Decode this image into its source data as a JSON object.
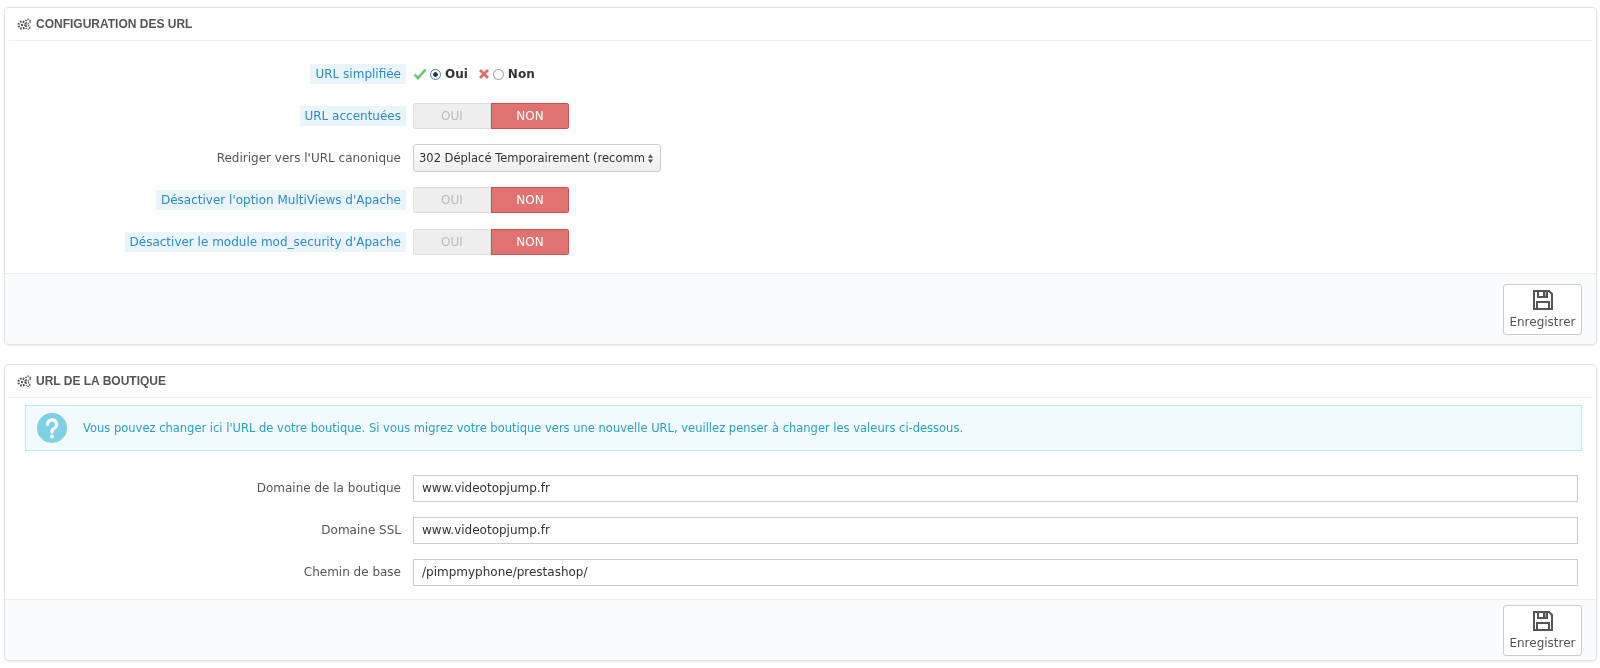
{
  "panels": [
    {
      "title": "CONFIGURATION DES URL",
      "fields": [
        {
          "kind": "radio",
          "label": "URL simplifiée",
          "hint": true,
          "options": [
            {
              "label": "Oui",
              "selected": true
            },
            {
              "label": "Non",
              "selected": false
            }
          ]
        },
        {
          "kind": "switch",
          "label": "URL accentuées",
          "hint": true,
          "options": [
            {
              "label": "OUI",
              "selected": false
            },
            {
              "label": "NON",
              "selected": true
            }
          ]
        },
        {
          "kind": "select",
          "label": "Rediriger vers l'URL canonique",
          "hint": false,
          "value": "302 Déplacé Temporairement (recomm"
        },
        {
          "kind": "switch",
          "label": "Désactiver l'option MultiViews d'Apache",
          "hint": true,
          "options": [
            {
              "label": "OUI",
              "selected": false
            },
            {
              "label": "NON",
              "selected": true
            }
          ]
        },
        {
          "kind": "switch",
          "label": "Désactiver le module mod_security d'Apache",
          "hint": true,
          "options": [
            {
              "label": "OUI",
              "selected": false
            },
            {
              "label": "NON",
              "selected": true
            }
          ]
        }
      ],
      "save_button": "Enregistrer"
    },
    {
      "title": "URL DE LA BOUTIQUE",
      "alert": "Vous pouvez changer ici l'URL de votre boutique. Si vous migrez votre boutique vers une nouvelle URL, veuillez penser à changer les valeurs ci-dessous.",
      "fields": [
        {
          "kind": "text",
          "label": "Domaine de la boutique",
          "hint": false,
          "value": "www.videotopjump.fr"
        },
        {
          "kind": "text",
          "label": "Domaine SSL",
          "hint": false,
          "value": "www.videotopjump.fr"
        },
        {
          "kind": "text",
          "label": "Chemin de base",
          "hint": false,
          "value": "/pimpmyphone/prestashop/"
        }
      ],
      "save_button": "Enregistrer"
    }
  ]
}
